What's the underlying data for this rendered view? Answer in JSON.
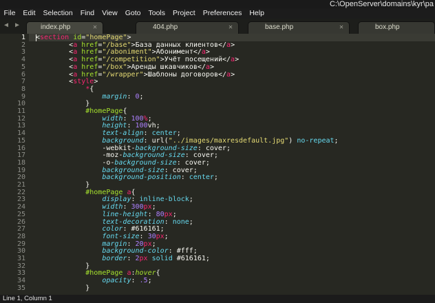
{
  "window": {
    "title": "C:\\OpenServer\\domains\\kyr\\pa"
  },
  "menu": [
    "File",
    "Edit",
    "Selection",
    "Find",
    "View",
    "Goto",
    "Tools",
    "Project",
    "Preferences",
    "Help"
  ],
  "tabs": [
    {
      "label": "index.php",
      "active": true
    },
    {
      "label": "404.php",
      "active": false
    },
    {
      "label": "base.php",
      "active": false
    },
    {
      "label": "box.php",
      "active": false
    }
  ],
  "nav": {
    "prev_icon": "arrow-left-icon",
    "next_icon": "arrow-right-icon",
    "close_icon": "close-x-icon"
  },
  "editor": {
    "current_line": 1,
    "lines": [
      [
        [
          "<",
          "w"
        ],
        [
          "section",
          "k"
        ],
        [
          " ",
          "w"
        ],
        [
          "id",
          "a"
        ],
        [
          "=",
          "w"
        ],
        [
          "\"homePage\"",
          "s"
        ],
        [
          ">",
          "w"
        ]
      ],
      [
        [
          "        ",
          "w"
        ],
        [
          "<",
          "w"
        ],
        [
          "a",
          "k"
        ],
        [
          " ",
          "w"
        ],
        [
          "href",
          "a"
        ],
        [
          "=",
          "w"
        ],
        [
          "\"/base\"",
          "s"
        ],
        [
          ">База данных клиентов</",
          "w"
        ],
        [
          "a",
          "k"
        ],
        [
          ">",
          "w"
        ]
      ],
      [
        [
          "        ",
          "w"
        ],
        [
          "<",
          "w"
        ],
        [
          "a",
          "k"
        ],
        [
          " ",
          "w"
        ],
        [
          "href",
          "a"
        ],
        [
          "=",
          "w"
        ],
        [
          "\"/aboniment\"",
          "s"
        ],
        [
          ">Абонимент</",
          "w"
        ],
        [
          "a",
          "k"
        ],
        [
          ">",
          "w"
        ]
      ],
      [
        [
          "        ",
          "w"
        ],
        [
          "<",
          "w"
        ],
        [
          "a",
          "k"
        ],
        [
          " ",
          "w"
        ],
        [
          "href",
          "a"
        ],
        [
          "=",
          "w"
        ],
        [
          "\"/competition\"",
          "s"
        ],
        [
          ">Учёт посещений</",
          "w"
        ],
        [
          "a",
          "k"
        ],
        [
          ">",
          "w"
        ]
      ],
      [
        [
          "        ",
          "w"
        ],
        [
          "<",
          "w"
        ],
        [
          "a",
          "k"
        ],
        [
          " ",
          "w"
        ],
        [
          "href",
          "a"
        ],
        [
          "=",
          "w"
        ],
        [
          "\"/box\"",
          "s"
        ],
        [
          ">Аренды шкавчиков</",
          "w"
        ],
        [
          "a",
          "k"
        ],
        [
          ">",
          "w"
        ]
      ],
      [
        [
          "        ",
          "w"
        ],
        [
          "<",
          "w"
        ],
        [
          "a",
          "k"
        ],
        [
          " ",
          "w"
        ],
        [
          "href",
          "a"
        ],
        [
          "=",
          "w"
        ],
        [
          "\"/wrapper\"",
          "s"
        ],
        [
          ">Шаблоны договоров</",
          "w"
        ],
        [
          "a",
          "k"
        ],
        [
          ">",
          "w"
        ]
      ],
      [
        [
          "        ",
          "w"
        ],
        [
          "<",
          "w"
        ],
        [
          "style",
          "k"
        ],
        [
          ">",
          "w"
        ]
      ],
      [
        [
          "            ",
          "w"
        ],
        [
          "*",
          "k"
        ],
        [
          "{",
          "w"
        ]
      ],
      [
        [
          "                ",
          "w"
        ],
        [
          "margin",
          "p"
        ],
        [
          ": ",
          "w"
        ],
        [
          "0",
          "n"
        ],
        [
          ";",
          "w"
        ]
      ],
      [
        [
          "            ",
          "w"
        ],
        [
          "}",
          "w"
        ]
      ],
      [
        [
          "            ",
          "w"
        ],
        [
          "#homePage",
          "g"
        ],
        [
          "{",
          "w"
        ]
      ],
      [
        [
          "                ",
          "w"
        ],
        [
          "width",
          "p"
        ],
        [
          ": ",
          "w"
        ],
        [
          "100",
          "n"
        ],
        [
          "%",
          "u"
        ],
        [
          ";",
          "w"
        ]
      ],
      [
        [
          "                ",
          "w"
        ],
        [
          "height",
          "p"
        ],
        [
          ": ",
          "w"
        ],
        [
          "100",
          "n"
        ],
        [
          "vh",
          "w"
        ],
        [
          ";",
          "w"
        ]
      ],
      [
        [
          "                ",
          "w"
        ],
        [
          "text-align",
          "p"
        ],
        [
          ": ",
          "w"
        ],
        [
          "center",
          "v"
        ],
        [
          ";",
          "w"
        ]
      ],
      [
        [
          "                ",
          "w"
        ],
        [
          "background",
          "p"
        ],
        [
          ": ",
          "w"
        ],
        [
          "url(",
          "w"
        ],
        [
          "\"../images/maxresdefault.jpg\"",
          "s"
        ],
        [
          ") ",
          "w"
        ],
        [
          "no-repeat",
          "v"
        ],
        [
          ";",
          "w"
        ]
      ],
      [
        [
          "                ",
          "w"
        ],
        [
          "-webkit-",
          "w"
        ],
        [
          "background-size",
          "p"
        ],
        [
          ": cover;",
          "w"
        ]
      ],
      [
        [
          "                ",
          "w"
        ],
        [
          "-moz-",
          "w"
        ],
        [
          "background-size",
          "p"
        ],
        [
          ": cover;",
          "w"
        ]
      ],
      [
        [
          "                ",
          "w"
        ],
        [
          "-o-",
          "w"
        ],
        [
          "background-size",
          "p"
        ],
        [
          ": cover;",
          "w"
        ]
      ],
      [
        [
          "                ",
          "w"
        ],
        [
          "background-size",
          "p"
        ],
        [
          ": cover;",
          "w"
        ]
      ],
      [
        [
          "                ",
          "w"
        ],
        [
          "background-position",
          "p"
        ],
        [
          ": ",
          "w"
        ],
        [
          "center",
          "v"
        ],
        [
          ";",
          "w"
        ]
      ],
      [
        [
          "            ",
          "w"
        ],
        [
          "}",
          "w"
        ]
      ],
      [
        [
          "            ",
          "w"
        ],
        [
          "#homePage",
          "g"
        ],
        [
          " ",
          "w"
        ],
        [
          "a",
          "k"
        ],
        [
          "{",
          "w"
        ]
      ],
      [
        [
          "                ",
          "w"
        ],
        [
          "display",
          "p"
        ],
        [
          ": ",
          "w"
        ],
        [
          "inline-block",
          "v"
        ],
        [
          ";",
          "w"
        ]
      ],
      [
        [
          "                ",
          "w"
        ],
        [
          "width",
          "p"
        ],
        [
          ": ",
          "w"
        ],
        [
          "300",
          "n"
        ],
        [
          "px",
          "u"
        ],
        [
          ";",
          "w"
        ]
      ],
      [
        [
          "                ",
          "w"
        ],
        [
          "line-height",
          "p"
        ],
        [
          ": ",
          "w"
        ],
        [
          "80",
          "n"
        ],
        [
          "px",
          "u"
        ],
        [
          ";",
          "w"
        ]
      ],
      [
        [
          "                ",
          "w"
        ],
        [
          "text-decoration",
          "p"
        ],
        [
          ": ",
          "w"
        ],
        [
          "none",
          "v"
        ],
        [
          ";",
          "w"
        ]
      ],
      [
        [
          "                ",
          "w"
        ],
        [
          "color",
          "p"
        ],
        [
          ": ",
          "w"
        ],
        [
          "#616161",
          "w"
        ],
        [
          ";",
          "w"
        ]
      ],
      [
        [
          "                ",
          "w"
        ],
        [
          "font-size",
          "p"
        ],
        [
          ": ",
          "w"
        ],
        [
          "30",
          "n"
        ],
        [
          "px",
          "u"
        ],
        [
          ";",
          "w"
        ]
      ],
      [
        [
          "                ",
          "w"
        ],
        [
          "margin",
          "p"
        ],
        [
          ": ",
          "w"
        ],
        [
          "20",
          "n"
        ],
        [
          "px",
          "u"
        ],
        [
          ";",
          "w"
        ]
      ],
      [
        [
          "                ",
          "w"
        ],
        [
          "background-color",
          "p"
        ],
        [
          ": ",
          "w"
        ],
        [
          "#fff",
          "w"
        ],
        [
          ";",
          "w"
        ]
      ],
      [
        [
          "                ",
          "w"
        ],
        [
          "border",
          "p"
        ],
        [
          ": ",
          "w"
        ],
        [
          "2",
          "n"
        ],
        [
          "px",
          "u"
        ],
        [
          " ",
          "w"
        ],
        [
          "solid",
          "v"
        ],
        [
          " ",
          "w"
        ],
        [
          "#616161",
          "w"
        ],
        [
          ";",
          "w"
        ]
      ],
      [
        [
          "            ",
          "w"
        ],
        [
          "}",
          "w"
        ]
      ],
      [
        [
          "            ",
          "w"
        ],
        [
          "#homePage",
          "g"
        ],
        [
          " ",
          "w"
        ],
        [
          "a",
          "k"
        ],
        [
          ":",
          "w"
        ],
        [
          "hover",
          "gi"
        ],
        [
          "{",
          "w"
        ]
      ],
      [
        [
          "                ",
          "w"
        ],
        [
          "opacity",
          "p"
        ],
        [
          ": ",
          "w"
        ],
        [
          ".5",
          "n"
        ],
        [
          ";",
          "w"
        ]
      ],
      [
        [
          "            ",
          "w"
        ],
        [
          "}",
          "w"
        ]
      ]
    ]
  },
  "status": {
    "text": "Line 1, Column 1"
  },
  "colors": {
    "background": "#272822",
    "keyword": "#f92672",
    "attribute": "#a6e22e",
    "string": "#e6db74",
    "property": "#66d9ef",
    "number": "#ae81ff"
  }
}
